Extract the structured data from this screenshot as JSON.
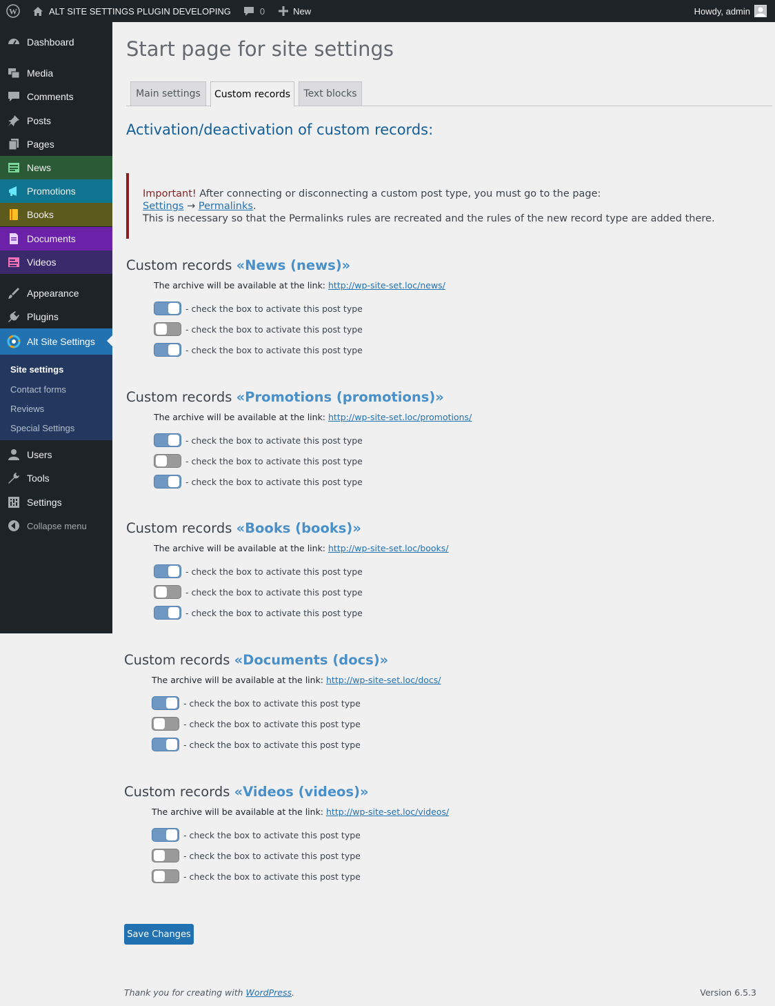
{
  "adminbar": {
    "site_name": "ALT SITE SETTINGS PLUGIN DEVELOPING",
    "comments_count": "0",
    "new_label": "New",
    "howdy": "Howdy, admin"
  },
  "sidebar": {
    "items": [
      {
        "label": "Dashboard",
        "icon": "dashboard-icon"
      },
      {
        "label": "Media",
        "icon": "media-icon"
      },
      {
        "label": "Comments",
        "icon": "comments-icon"
      },
      {
        "label": "Posts",
        "icon": "pin-icon"
      },
      {
        "label": "Pages",
        "icon": "pages-icon"
      },
      {
        "label": "News",
        "icon": "news-icon",
        "bg": "#2b5a36"
      },
      {
        "label": "Promotions",
        "icon": "megaphone-icon",
        "bg": "#0e7490"
      },
      {
        "label": "Books",
        "icon": "book-icon",
        "bg": "#5c5a1c"
      },
      {
        "label": "Documents",
        "icon": "document-icon",
        "bg": "#6b21a8"
      },
      {
        "label": "Videos",
        "icon": "video-icon",
        "bg": "#3b2a6b"
      },
      {
        "label": "Appearance",
        "icon": "brush-icon"
      },
      {
        "label": "Plugins",
        "icon": "plugin-icon"
      },
      {
        "label": "Alt Site Settings",
        "icon": "gear-icon"
      },
      {
        "label": "Users",
        "icon": "users-icon"
      },
      {
        "label": "Tools",
        "icon": "wrench-icon"
      },
      {
        "label": "Settings",
        "icon": "settings-icon"
      }
    ],
    "submenu": [
      "Site settings",
      "Contact forms",
      "Reviews",
      "Special Settings"
    ],
    "collapse": "Collapse menu"
  },
  "page": {
    "title": "Start page for site settings",
    "tabs": [
      "Main settings",
      "Custom records",
      "Text blocks"
    ],
    "active_tab": "Custom records",
    "section_heading": "Activation/deactivation of custom records:"
  },
  "notice": {
    "important": "Important!",
    "text1": " After connecting or disconnecting a custom post type, you must go to the page:",
    "link1": "Settings",
    "arrow": " → ",
    "link2": "Permalinks",
    "dot": ".",
    "text2": "This is necessary so that the Permalinks rules are recreated and the rules of the new record type are added there."
  },
  "groups": [
    {
      "prefix": "Custom records ",
      "name": "«News (news)»",
      "archive_label": "The archive will be available at the link: ",
      "archive_url": "http://wp-site-set.loc/news/",
      "toggles": [
        true,
        false,
        true
      ]
    },
    {
      "prefix": "Custom records ",
      "name": "«Promotions (promotions)»",
      "archive_label": "The archive will be available at the link: ",
      "archive_url": "http://wp-site-set.loc/promotions/",
      "toggles": [
        true,
        false,
        true
      ]
    },
    {
      "prefix": "Custom records ",
      "name": "«Books (books)»",
      "archive_label": "The archive will be available at the link: ",
      "archive_url": "http://wp-site-set.loc/books/",
      "toggles": [
        true,
        false,
        true
      ]
    },
    {
      "prefix": "Custom records ",
      "name": "«Documents (docs)»",
      "archive_label": "The archive will be available at the link: ",
      "archive_url": "http://wp-site-set.loc/docs/",
      "toggles": [
        true,
        false,
        true
      ]
    },
    {
      "prefix": "Custom records ",
      "name": "«Videos (videos)»",
      "archive_label": "The archive will be available at the link: ",
      "archive_url": "http://wp-site-set.loc/videos/",
      "toggles": [
        true,
        false,
        false
      ]
    }
  ],
  "toggle_label": "- check the box to activate this post type",
  "save_button": "Save Changes",
  "footer": {
    "thanks_prefix": "Thank you for creating with ",
    "wordpress_link": "WordPress",
    "thanks_suffix": ".",
    "version": "Version 6.5.3"
  },
  "colors": {
    "accent": "#2271b1",
    "toggle_on": "#6e97c2",
    "toggle_off": "#9a9a9a"
  }
}
